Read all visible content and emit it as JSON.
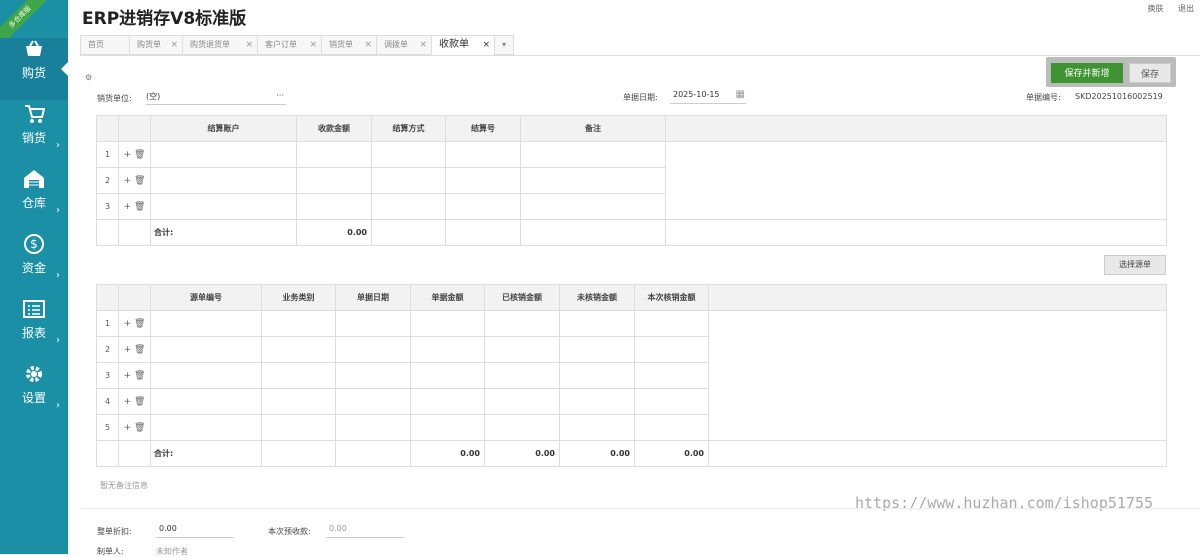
{
  "app": {
    "title": "ERP进销存V8标准版",
    "ribbon": "多仓库版"
  },
  "toplinks": [
    "换肤",
    "退出"
  ],
  "sidebar": {
    "items": [
      {
        "label": "购货",
        "icon": "basket-icon",
        "arrow": ""
      },
      {
        "label": "销货",
        "icon": "cart-icon",
        "arrow": "›"
      },
      {
        "label": "仓库",
        "icon": "warehouse-icon",
        "arrow": "›"
      },
      {
        "label": "资金",
        "icon": "dollar-icon",
        "arrow": "›"
      },
      {
        "label": "报表",
        "icon": "report-icon",
        "arrow": "›"
      },
      {
        "label": "设置",
        "icon": "gear-icon",
        "arrow": "›"
      }
    ]
  },
  "tabs": [
    {
      "label": "首页"
    },
    {
      "label": "购货单"
    },
    {
      "label": "购货退货单"
    },
    {
      "label": "客户订单"
    },
    {
      "label": "销货单"
    },
    {
      "label": "调拨单"
    },
    {
      "label": "收款单"
    }
  ],
  "toolbar": {
    "save_new": "保存并新增",
    "save": "保存"
  },
  "form": {
    "customer_label": "销货单位:",
    "customer_value": "(空)",
    "customer_more": "···",
    "date_label": "单据日期:",
    "date_value": "2025-10-15",
    "no_label": "单据编号:",
    "no_value": "SKD20251016002519"
  },
  "table1": {
    "headers": [
      "结算账户",
      "收款金额",
      "结算方式",
      "结算号",
      "备注"
    ],
    "rows": [
      "1",
      "2",
      "3"
    ],
    "total_label": "合计:",
    "total_amount": "0.00"
  },
  "select_source": "选择源单",
  "table2": {
    "headers": [
      "源单编号",
      "业务类别",
      "单据日期",
      "单据金额",
      "已核销金额",
      "未核销金额",
      "本次核销金额"
    ],
    "rows": [
      "1",
      "2",
      "3",
      "4",
      "5"
    ],
    "total_label": "合计:",
    "totals": [
      "0.00",
      "0.00",
      "0.00",
      "0.00"
    ]
  },
  "ops": {
    "add": "+",
    "del": "🗑"
  },
  "note": "暂无备注信息",
  "bottom": {
    "discount_label": "整单折扣:",
    "discount_value": "0.00",
    "prepay_label": "本次预收款:",
    "prepay_value": "0.00",
    "maker_label": "制单人:",
    "maker_value": "未知作者"
  },
  "watermark": "https://www.huzhan.com/ishop51755"
}
